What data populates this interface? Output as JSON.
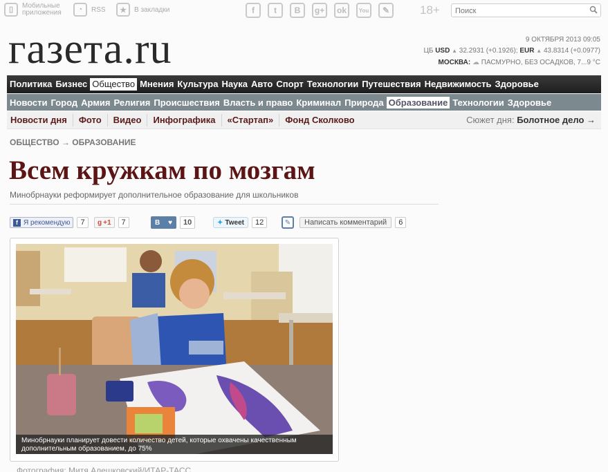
{
  "topbar": {
    "mobile_label": "Мобильные приложения",
    "rss_label": "RSS",
    "bookmarks_label": "В закладки",
    "social": [
      "f",
      "t",
      "B",
      "g+",
      "ok",
      "You",
      "✎"
    ],
    "age_rating": "18+",
    "search_placeholder": "Поиск"
  },
  "header": {
    "logo": "газета.ru",
    "date": "9 ОКТЯБРЯ 2013 09:05",
    "rates_prefix": "ЦБ",
    "usd_label": "USD",
    "usd_value": "32.2931 (+0.1926);",
    "eur_label": "EUR",
    "eur_value": "43.8314 (+0.0977)",
    "city": "МОСКВА:",
    "weather": "ПАСМУРНО, БЕЗ ОСАДКОВ, 7...9 °С"
  },
  "nav_main": [
    "Политика",
    "Бизнес",
    "Общество",
    "Мнения",
    "Культура",
    "Наука",
    "Авто",
    "Спорт",
    "Технологии",
    "Путешествия",
    "Недвижимость",
    "Здоровье"
  ],
  "nav_sub": [
    "Новости",
    "Город",
    "Армия",
    "Религия",
    "Происшествия",
    "Власть и право",
    "Криминал",
    "Природа",
    "Образование",
    "Технологии",
    "Здоровье"
  ],
  "nav_extra": [
    "Новости дня",
    "Фото",
    "Видео",
    "Инфографика",
    "«Стартап»",
    "Фонд Сколково"
  ],
  "plot": {
    "label": "Сюжет дня:",
    "link": "Болотное дело →"
  },
  "article": {
    "breadcrumb": "ОБЩЕСТВО → ОБРАЗОВАНИЕ",
    "title": "Всем кружкам по мозгам",
    "subtitle": "Минобрнауки реформирует дополнительное образование для школьников",
    "photo_caption": "Минобрнауки планирует довести количество детей, которые охвачены качественным дополнительным образованием, до 75%",
    "photo_credit": "Фотография: Митя Алешковский/ИТАР-ТАСС"
  },
  "share": {
    "fb_label": "Я рекомендую",
    "fb_count": "7",
    "gplus_label": "+1",
    "gplus_count": "7",
    "vk_count": "10",
    "tweet_label": "Tweet",
    "tweet_count": "12",
    "comment_label": "Написать комментарий",
    "comment_count": "6"
  },
  "colors": {
    "headline": "#5c1414",
    "nav_dark": "#2a2a2a",
    "nav_grey": "#7c8a90",
    "extra_link": "#5b1a1a"
  }
}
